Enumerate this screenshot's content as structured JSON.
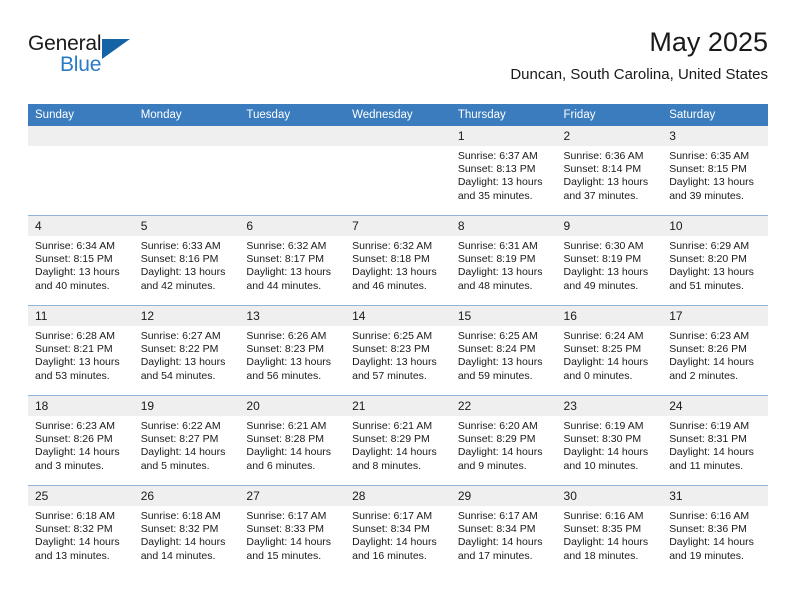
{
  "brand": {
    "name_line1": "General",
    "name_line2": "Blue",
    "triangle_color": "#1464a5",
    "blue_text_color": "#2b7cc4"
  },
  "header": {
    "month_title": "May 2025",
    "location": "Duncan, South Carolina, United States",
    "header_bg_color": "#3a7cbd",
    "daynum_bg_color": "#efefef",
    "grid_line_color": "#8fb4d6"
  },
  "weekday_headers": [
    "Sunday",
    "Monday",
    "Tuesday",
    "Wednesday",
    "Thursday",
    "Friday",
    "Saturday"
  ],
  "labels": {
    "sunrise_prefix": "Sunrise:",
    "sunset_prefix": "Sunset:",
    "daylight_prefix": "Daylight:"
  },
  "weeks": [
    [
      {
        "day": "",
        "line1": "",
        "line2": "",
        "line3": "",
        "line4": ""
      },
      {
        "day": "",
        "line1": "",
        "line2": "",
        "line3": "",
        "line4": ""
      },
      {
        "day": "",
        "line1": "",
        "line2": "",
        "line3": "",
        "line4": ""
      },
      {
        "day": "",
        "line1": "",
        "line2": "",
        "line3": "",
        "line4": ""
      },
      {
        "day": "1",
        "line1": "Sunrise: 6:37 AM",
        "line2": "Sunset: 8:13 PM",
        "line3": "Daylight: 13 hours",
        "line4": "and 35 minutes."
      },
      {
        "day": "2",
        "line1": "Sunrise: 6:36 AM",
        "line2": "Sunset: 8:14 PM",
        "line3": "Daylight: 13 hours",
        "line4": "and 37 minutes."
      },
      {
        "day": "3",
        "line1": "Sunrise: 6:35 AM",
        "line2": "Sunset: 8:15 PM",
        "line3": "Daylight: 13 hours",
        "line4": "and 39 minutes."
      }
    ],
    [
      {
        "day": "4",
        "line1": "Sunrise: 6:34 AM",
        "line2": "Sunset: 8:15 PM",
        "line3": "Daylight: 13 hours",
        "line4": "and 40 minutes."
      },
      {
        "day": "5",
        "line1": "Sunrise: 6:33 AM",
        "line2": "Sunset: 8:16 PM",
        "line3": "Daylight: 13 hours",
        "line4": "and 42 minutes."
      },
      {
        "day": "6",
        "line1": "Sunrise: 6:32 AM",
        "line2": "Sunset: 8:17 PM",
        "line3": "Daylight: 13 hours",
        "line4": "and 44 minutes."
      },
      {
        "day": "7",
        "line1": "Sunrise: 6:32 AM",
        "line2": "Sunset: 8:18 PM",
        "line3": "Daylight: 13 hours",
        "line4": "and 46 minutes."
      },
      {
        "day": "8",
        "line1": "Sunrise: 6:31 AM",
        "line2": "Sunset: 8:19 PM",
        "line3": "Daylight: 13 hours",
        "line4": "and 48 minutes."
      },
      {
        "day": "9",
        "line1": "Sunrise: 6:30 AM",
        "line2": "Sunset: 8:19 PM",
        "line3": "Daylight: 13 hours",
        "line4": "and 49 minutes."
      },
      {
        "day": "10",
        "line1": "Sunrise: 6:29 AM",
        "line2": "Sunset: 8:20 PM",
        "line3": "Daylight: 13 hours",
        "line4": "and 51 minutes."
      }
    ],
    [
      {
        "day": "11",
        "line1": "Sunrise: 6:28 AM",
        "line2": "Sunset: 8:21 PM",
        "line3": "Daylight: 13 hours",
        "line4": "and 53 minutes."
      },
      {
        "day": "12",
        "line1": "Sunrise: 6:27 AM",
        "line2": "Sunset: 8:22 PM",
        "line3": "Daylight: 13 hours",
        "line4": "and 54 minutes."
      },
      {
        "day": "13",
        "line1": "Sunrise: 6:26 AM",
        "line2": "Sunset: 8:23 PM",
        "line3": "Daylight: 13 hours",
        "line4": "and 56 minutes."
      },
      {
        "day": "14",
        "line1": "Sunrise: 6:25 AM",
        "line2": "Sunset: 8:23 PM",
        "line3": "Daylight: 13 hours",
        "line4": "and 57 minutes."
      },
      {
        "day": "15",
        "line1": "Sunrise: 6:25 AM",
        "line2": "Sunset: 8:24 PM",
        "line3": "Daylight: 13 hours",
        "line4": "and 59 minutes."
      },
      {
        "day": "16",
        "line1": "Sunrise: 6:24 AM",
        "line2": "Sunset: 8:25 PM",
        "line3": "Daylight: 14 hours",
        "line4": "and 0 minutes."
      },
      {
        "day": "17",
        "line1": "Sunrise: 6:23 AM",
        "line2": "Sunset: 8:26 PM",
        "line3": "Daylight: 14 hours",
        "line4": "and 2 minutes."
      }
    ],
    [
      {
        "day": "18",
        "line1": "Sunrise: 6:23 AM",
        "line2": "Sunset: 8:26 PM",
        "line3": "Daylight: 14 hours",
        "line4": "and 3 minutes."
      },
      {
        "day": "19",
        "line1": "Sunrise: 6:22 AM",
        "line2": "Sunset: 8:27 PM",
        "line3": "Daylight: 14 hours",
        "line4": "and 5 minutes."
      },
      {
        "day": "20",
        "line1": "Sunrise: 6:21 AM",
        "line2": "Sunset: 8:28 PM",
        "line3": "Daylight: 14 hours",
        "line4": "and 6 minutes."
      },
      {
        "day": "21",
        "line1": "Sunrise: 6:21 AM",
        "line2": "Sunset: 8:29 PM",
        "line3": "Daylight: 14 hours",
        "line4": "and 8 minutes."
      },
      {
        "day": "22",
        "line1": "Sunrise: 6:20 AM",
        "line2": "Sunset: 8:29 PM",
        "line3": "Daylight: 14 hours",
        "line4": "and 9 minutes."
      },
      {
        "day": "23",
        "line1": "Sunrise: 6:19 AM",
        "line2": "Sunset: 8:30 PM",
        "line3": "Daylight: 14 hours",
        "line4": "and 10 minutes."
      },
      {
        "day": "24",
        "line1": "Sunrise: 6:19 AM",
        "line2": "Sunset: 8:31 PM",
        "line3": "Daylight: 14 hours",
        "line4": "and 11 minutes."
      }
    ],
    [
      {
        "day": "25",
        "line1": "Sunrise: 6:18 AM",
        "line2": "Sunset: 8:32 PM",
        "line3": "Daylight: 14 hours",
        "line4": "and 13 minutes."
      },
      {
        "day": "26",
        "line1": "Sunrise: 6:18 AM",
        "line2": "Sunset: 8:32 PM",
        "line3": "Daylight: 14 hours",
        "line4": "and 14 minutes."
      },
      {
        "day": "27",
        "line1": "Sunrise: 6:17 AM",
        "line2": "Sunset: 8:33 PM",
        "line3": "Daylight: 14 hours",
        "line4": "and 15 minutes."
      },
      {
        "day": "28",
        "line1": "Sunrise: 6:17 AM",
        "line2": "Sunset: 8:34 PM",
        "line3": "Daylight: 14 hours",
        "line4": "and 16 minutes."
      },
      {
        "day": "29",
        "line1": "Sunrise: 6:17 AM",
        "line2": "Sunset: 8:34 PM",
        "line3": "Daylight: 14 hours",
        "line4": "and 17 minutes."
      },
      {
        "day": "30",
        "line1": "Sunrise: 6:16 AM",
        "line2": "Sunset: 8:35 PM",
        "line3": "Daylight: 14 hours",
        "line4": "and 18 minutes."
      },
      {
        "day": "31",
        "line1": "Sunrise: 6:16 AM",
        "line2": "Sunset: 8:36 PM",
        "line3": "Daylight: 14 hours",
        "line4": "and 19 minutes."
      }
    ]
  ]
}
